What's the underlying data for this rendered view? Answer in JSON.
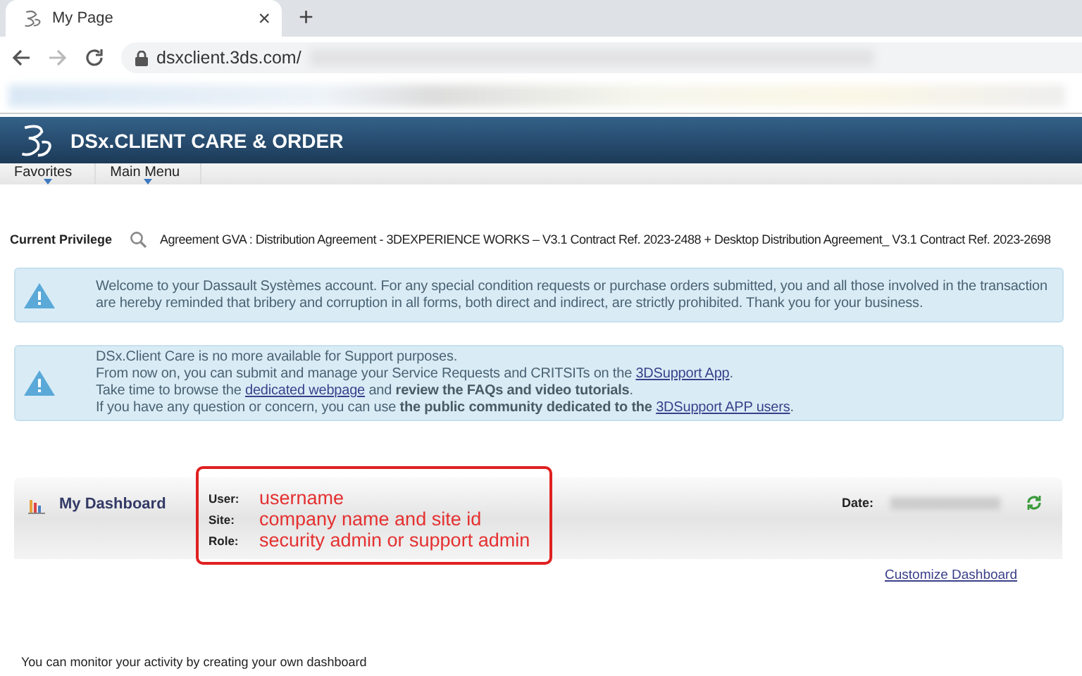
{
  "browser": {
    "tab_title": "My Page",
    "tab_close": "×",
    "new_tab": "+",
    "address": "dsxclient.3ds.com/"
  },
  "header": {
    "title": "DSx.CLIENT CARE & ORDER"
  },
  "menu": [
    {
      "label": "Favorites"
    },
    {
      "label": "Main Menu"
    }
  ],
  "privilege": {
    "label": "Current Privilege",
    "value": "Agreement GVA : Distribution Agreement -  3DEXPERIENCE WORKS – V3.1 Contract Ref. 2023-2488 + Desktop Distribution Agreement_ V3.1 Contract Ref. 2023-2698"
  },
  "notices": [
    {
      "lines": [
        [
          {
            "text": "Welcome to your Dassault Systèmes account. For any special condition requests or purchase orders submitted, you and all those involved in the transaction",
            "link": false
          }
        ],
        [
          {
            "text": "are hereby reminded that bribery and corruption in all forms, both direct and indirect, are strictly prohibited. Thank you for your business.",
            "link": false
          }
        ]
      ]
    },
    {
      "lines": [
        [
          {
            "text": "DSx.Client Care is no more available for Support purposes.",
            "link": false
          }
        ],
        [
          {
            "text": "From now on, you can submit and manage your Service Requests and CRITSITs on the ",
            "link": false
          },
          {
            "text": "3DSupport App",
            "link": true
          },
          {
            "text": ".",
            "link": false
          }
        ],
        [
          {
            "text": "Take time to browse the ",
            "link": false
          },
          {
            "text": "dedicated webpage",
            "link": true
          },
          {
            "text": " and **review the FAQs and video tutorials**.",
            "link": false
          }
        ],
        [
          {
            "text": "If you have any question or concern, you can use **the public community dedicated to the** ",
            "link": false
          },
          {
            "text": "3DSupport APP users",
            "link": true
          },
          {
            "text": ".",
            "link": false
          }
        ]
      ]
    }
  ],
  "dashboard": {
    "title": "My Dashboard",
    "date_label": "Date:",
    "fields": [
      {
        "label": "User:",
        "value": "username"
      },
      {
        "label": "Site:",
        "value": "company name and site id"
      },
      {
        "label": "Role:",
        "value": "security admin or support admin"
      }
    ],
    "customize_link": "Customize Dashboard",
    "empty_message": "You can monitor your activity by creating your own dashboard"
  }
}
